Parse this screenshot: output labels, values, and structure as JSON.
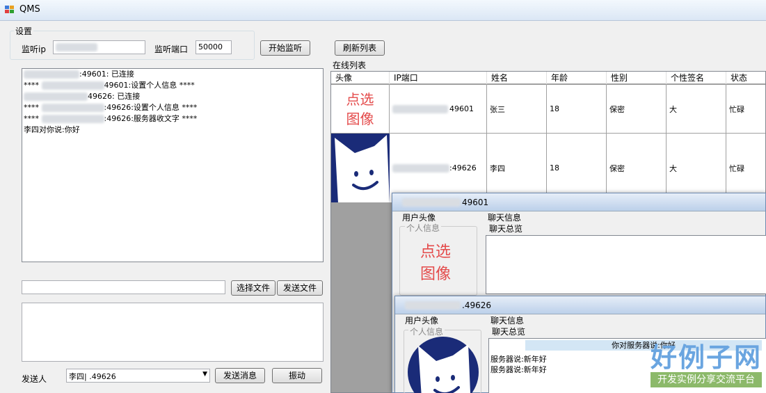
{
  "window": {
    "title": "QMS"
  },
  "settings": {
    "legend": "设置",
    "ip_label": "监听ip",
    "port_label": "监听端口",
    "port_value": "50000",
    "start_button": "开始监听",
    "refresh_button": "刷新列表"
  },
  "log": {
    "lines": [
      {
        "prefix": "",
        "text": ":49601: 已连接"
      },
      {
        "prefix": "****",
        "text": "49601:设置个人信息    ****"
      },
      {
        "prefix": "",
        "text": "49626: 已连接"
      },
      {
        "prefix": "****",
        "text": ":49626:设置个人信息    ****"
      },
      {
        "prefix": "****",
        "text": ":49626:服务器收文字    ****"
      },
      {
        "prefix": "",
        "text": "李四对你说:你好"
      }
    ]
  },
  "file": {
    "path_value": "",
    "choose_button": "选择文件",
    "send_button": "发送文件"
  },
  "message": {
    "input_value": "",
    "sender_label": "发送人",
    "sender_value": "李四|                .49626",
    "send_button": "发送消息",
    "shake_button": "振动"
  },
  "online_list": {
    "label": "在线列表",
    "columns": [
      "头像",
      "IP端口",
      "姓名",
      "年龄",
      "性别",
      "个性签名",
      "状态"
    ],
    "rows": [
      {
        "avatar": "pick",
        "ip": "49601",
        "name": "张三",
        "age": "18",
        "gender": "保密",
        "signature": "大",
        "status": "忙碌"
      },
      {
        "avatar": "cat",
        "ip": ":49626",
        "name": "李四",
        "age": "18",
        "gender": "保密",
        "signature": "大",
        "status": "忙碌"
      }
    ],
    "pick_image_text": [
      "点选",
      "图像"
    ]
  },
  "chat1": {
    "title_suffix": "49601",
    "avatar_group": "用户头像",
    "personal_info": "个人信息",
    "chat_info": "聊天信息",
    "chat_overview": "聊天总览",
    "pick_image_text": [
      "点选",
      "图像"
    ]
  },
  "chat2": {
    "title_suffix": ".49626",
    "avatar_group": "用户头像",
    "personal_info": "个人信息",
    "chat_info": "聊天信息",
    "chat_overview": "聊天总览",
    "banner": "你对服务器说:你好",
    "messages": [
      "服务器说:新年好",
      "服务器说:新年好"
    ]
  },
  "watermark": {
    "big": "好例子网",
    "small": "开发实例分享交流平台"
  }
}
